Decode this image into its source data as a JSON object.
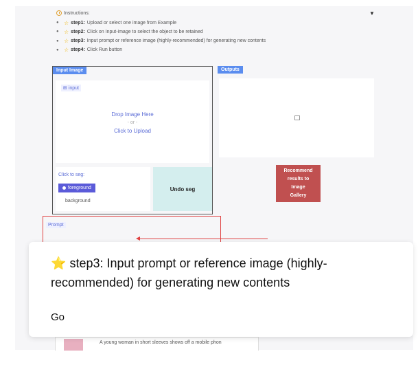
{
  "instructions": {
    "title": "Instructions:",
    "steps": [
      {
        "name": "step1:",
        "text": "Upload or select one image from Example"
      },
      {
        "name": "step2:",
        "text": "Click on Input-image to select the object to be retained"
      },
      {
        "name": "step3:",
        "text": "Input prompt or reference image (highly-recommended) for generating new contents"
      },
      {
        "name": "step4:",
        "text": "Click Run button"
      }
    ]
  },
  "input_panel": {
    "tag": "Input Image",
    "chip": "input",
    "drop_line1": "Drop Image Here",
    "drop_or": "- or -",
    "drop_line2": "Click to Upload"
  },
  "segmentation": {
    "label": "Click to seg:",
    "foreground": "foreground",
    "background": "background",
    "undo": "Undo seg"
  },
  "outputs": {
    "tag": "Outputs"
  },
  "recommend": {
    "line1": "Recommend",
    "line2": "results to",
    "line3": "Image",
    "line4": "Gallery"
  },
  "prompt": {
    "tag": "Prompt"
  },
  "tooltip": {
    "title": "step3:  Input prompt or reference image (highly-recommended) for generating new contents",
    "go": "Go"
  },
  "gallery": {
    "caption": "A young woman in short sleeves shows off a mobile phon"
  },
  "colors": {
    "accent": "#5b8def",
    "highlight": "#e04040",
    "recommend": "#c05050"
  }
}
